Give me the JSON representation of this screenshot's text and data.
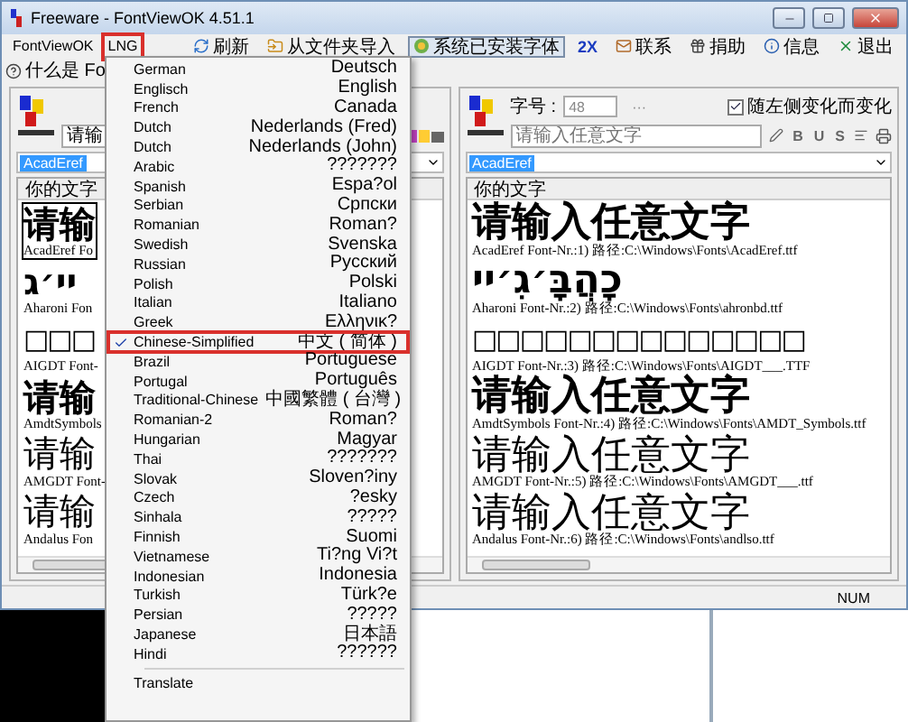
{
  "window": {
    "title": "Freeware - FontViewOK 4.51.1"
  },
  "menu_bar": [
    {
      "label": "FontViewOK",
      "annotated": false
    },
    {
      "label": "LNG",
      "annotated": true
    }
  ],
  "toolbar": [
    {
      "kind": "refresh",
      "label": "刷新",
      "pressed": false
    },
    {
      "kind": "import",
      "label": "从文件夹导入",
      "pressed": false
    },
    {
      "kind": "fonts",
      "label": "系统已安装字体",
      "pressed": true
    },
    {
      "kind": "zoom",
      "label": "2X",
      "pressed": false
    },
    {
      "kind": "contact",
      "label": "联系",
      "pressed": false
    },
    {
      "kind": "donate",
      "label": "捐助",
      "pressed": false
    },
    {
      "kind": "info",
      "label": "信息",
      "pressed": false
    },
    {
      "kind": "exit",
      "label": "退出",
      "pressed": false
    }
  ],
  "help_link": "什么是 Fo",
  "left_panel": {
    "text_input": "请输",
    "font_select": "AcadEref",
    "list_header": "你的文字",
    "fonts": [
      {
        "kind": "bold",
        "sample": "请输",
        "label": "AcadEref Fo",
        "selected": true
      },
      {
        "kind": "hebrew",
        "sample": "יי׳ג",
        "label": "Aharoni Fon",
        "selected": false
      },
      {
        "kind": "boxes",
        "sample": "□□□",
        "label": "AIGDT Font-",
        "selected": false
      },
      {
        "kind": "bold",
        "sample": "请输",
        "label": "AmdtSymbols",
        "selected": false
      },
      {
        "kind": "serif",
        "sample": "请输",
        "label": "AMGDT Font-",
        "selected": false
      },
      {
        "kind": "serif",
        "sample": "请输",
        "label": "Andalus Fon",
        "selected": false
      }
    ]
  },
  "right_panel": {
    "size_label": "字号 :",
    "size_value": "48",
    "more": "···",
    "follow_left": {
      "label": "随左侧变化而变化",
      "checked": true
    },
    "text_placeholder": "请输入任意文字",
    "format_buttons": [
      "B",
      "U",
      "S"
    ],
    "font_select": "AcadEref",
    "list_header": "你的文字",
    "fonts": [
      {
        "kind": "bold",
        "sample": "请输入任意文字",
        "label": "AcadEref Font-Nr.:1) 路径:C:\\Windows\\Fonts\\AcadEref.ttf",
        "selected": false
      },
      {
        "kind": "hebrew",
        "sample": "כָהֲבָּ׳גִ׳יי",
        "label": "Aharoni Font-Nr.:2) 路径:C:\\Windows\\Fonts\\ahronbd.ttf",
        "selected": false
      },
      {
        "kind": "boxes",
        "sample": "□□□□□□□□□□□□□□",
        "label": "AIGDT Font-Nr.:3) 路径:C:\\Windows\\Fonts\\AIGDT___.TTF",
        "selected": false
      },
      {
        "kind": "bold",
        "sample": "请输入任意文字",
        "label": "AmdtSymbols Font-Nr.:4) 路径:C:\\Windows\\Fonts\\AMDT_Symbols.ttf",
        "selected": false
      },
      {
        "kind": "serif",
        "sample": "请输入任意文字",
        "label": "AMGDT Font-Nr.:5) 路径:C:\\Windows\\Fonts\\AMGDT___.ttf",
        "selected": false
      },
      {
        "kind": "serif",
        "sample": "请输入任意文字",
        "label": "Andalus Font-Nr.:6) 路径:C:\\Windows\\Fonts\\andlso.ttf",
        "selected": false
      }
    ]
  },
  "status_bar": {
    "num": "NUM"
  },
  "language_menu": {
    "items": [
      {
        "name": "German",
        "native": "Deutsch",
        "selected": false
      },
      {
        "name": "Englisch",
        "native": "English",
        "selected": false
      },
      {
        "name": "French",
        "native": "Canada",
        "selected": false
      },
      {
        "name": "Dutch",
        "native": "Nederlands (Fred)",
        "selected": false
      },
      {
        "name": "Dutch",
        "native": "Nederlands (John)",
        "selected": false
      },
      {
        "name": "Arabic",
        "native": "???????",
        "selected": false
      },
      {
        "name": "Spanish",
        "native": "Espa?ol",
        "selected": false
      },
      {
        "name": "Serbian",
        "native": "Српски",
        "selected": false
      },
      {
        "name": "Romanian",
        "native": "Roman?",
        "selected": false
      },
      {
        "name": "Swedish",
        "native": "Svenska",
        "selected": false
      },
      {
        "name": "Russian",
        "native": "Русский",
        "selected": false
      },
      {
        "name": "Polish",
        "native": "Polski",
        "selected": false
      },
      {
        "name": "Italian",
        "native": "Italiano",
        "selected": false
      },
      {
        "name": "Greek",
        "native": "Ελληνικ?",
        "selected": false
      },
      {
        "name": "Chinese-Simplified",
        "native": "中文 ( 简体 )",
        "selected": true
      },
      {
        "name": "Brazil",
        "native": "Portuguese",
        "selected": false
      },
      {
        "name": "Portugal",
        "native": "Português",
        "selected": false
      },
      {
        "name": "Traditional-Chinese",
        "native": "中國繁體 ( 台灣 )",
        "selected": false
      },
      {
        "name": "Romanian-2",
        "native": "Roman?",
        "selected": false
      },
      {
        "name": "Hungarian",
        "native": "Magyar",
        "selected": false
      },
      {
        "name": "Thai",
        "native": "???????",
        "selected": false
      },
      {
        "name": "Slovak",
        "native": "Sloven?iny",
        "selected": false
      },
      {
        "name": "Czech",
        "native": "?esky",
        "selected": false
      },
      {
        "name": "Sinhala",
        "native": "?????",
        "selected": false
      },
      {
        "name": "Finnish",
        "native": "Suomi",
        "selected": false
      },
      {
        "name": "Vietnamese",
        "native": "Ti?ng Vi?t",
        "selected": false
      },
      {
        "name": "Indonesian",
        "native": "Indonesia",
        "selected": false
      },
      {
        "name": "Turkish",
        "native": "Türk?e",
        "selected": false
      },
      {
        "name": "Persian",
        "native": "?????",
        "selected": false
      },
      {
        "name": "Japanese",
        "native": "日本語",
        "selected": false
      },
      {
        "name": "Hindi",
        "native": "??????",
        "selected": false
      }
    ],
    "footer": "Translate"
  }
}
